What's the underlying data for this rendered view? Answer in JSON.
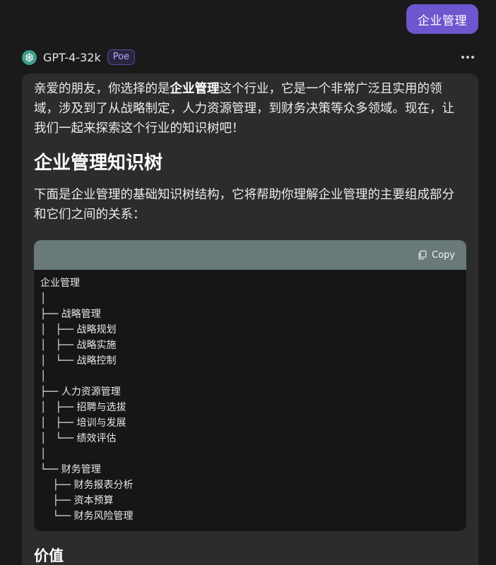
{
  "user_message": {
    "text": "企业管理"
  },
  "bot": {
    "name": "GPT-4-32k",
    "badge": "Poe",
    "icon": "openai-logo-icon",
    "more_icon": "more-horizontal-icon"
  },
  "response": {
    "intro_prefix": "亲爱的朋友，你选择的是",
    "intro_bold": "企业管理",
    "intro_suffix": "这个行业，它是一个非常广泛且实用的领域，涉及到了从战略制定，人力资源管理，到财务决策等众多领域。现在，让我们一起来探索这个行业的知识树吧！",
    "heading": "企业管理知识树",
    "description": "下面是企业管理的基础知识树结构，它将帮助你理解企业管理的主要组成部分和它们之间的关系：",
    "code_block": {
      "copy_label": "Copy",
      "copy_icon": "copy-icon",
      "lines": [
        "企业管理",
        "│",
        "├── 战略管理",
        "│   ├── 战略规划",
        "│   ├── 战略实施",
        "│   └── 战略控制",
        "│",
        "├── 人力资源管理",
        "│   ├── 招聘与选拔",
        "│   ├── 培训与发展",
        "│   └── 绩效评估",
        "│",
        "└── 财务管理",
        "    ├── 财务报表分析",
        "    ├── 资本预算",
        "    └── 财务风险管理"
      ]
    },
    "section_heading": "价值"
  },
  "colors": {
    "background": "#1a1a1a",
    "message_bg": "#2c2c2c",
    "user_bubble": "#6e56cf",
    "code_header": "#697a78",
    "code_bg": "#161616",
    "badge_text": "#b9a8ff"
  }
}
